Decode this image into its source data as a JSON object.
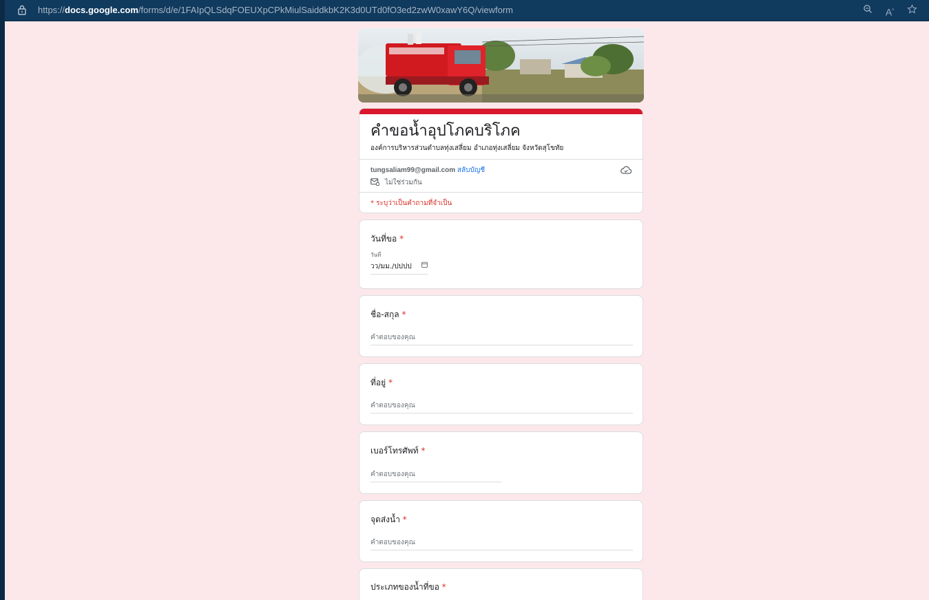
{
  "browser": {
    "url_prefix": "https://",
    "url_domain": "docs.google.com",
    "url_path": "/forms/d/e/1FAIpQLSdqFOEUXpCPkMiulSaiddkbK2K3d0UTd0fO3ed2zwW0xawY6Q/viewform"
  },
  "form": {
    "title": "คำขอน้ำอุปโภคบริโภค",
    "description": "องค์การบริหารส่วนตำบลทุ่งเสลี่ยม อำเภอทุ่งเสลี่ยม จังหวัดสุโขทัย",
    "account_email": "tungsaliam99@gmail.com",
    "switch_account": "สลับบัญชี",
    "not_shared": "ไม่ใช่ร่วมกัน",
    "required_note": "* ระบุว่าเป็นคำถามที่จำเป็น",
    "accent_color": "#d9182d"
  },
  "questions": [
    {
      "title": "วันที่ขอ",
      "star": "*",
      "sublabel": "วันที่",
      "value": "วว/มม./ปปปป"
    },
    {
      "title": "ชื่อ-สกุล",
      "star": "*",
      "placeholder": "คำตอบของคุณ"
    },
    {
      "title": "ที่อยู่",
      "star": "*",
      "placeholder": "คำตอบของคุณ"
    },
    {
      "title": "เบอร์โทรศัพท์",
      "star": "*",
      "placeholder": "คำตอบของคุณ"
    },
    {
      "title": "จุดส่งน้ำ",
      "star": "*",
      "placeholder": "คำตอบของคุณ"
    },
    {
      "title": "ประเภทของน้ำที่ขอ",
      "star": "*"
    }
  ]
}
